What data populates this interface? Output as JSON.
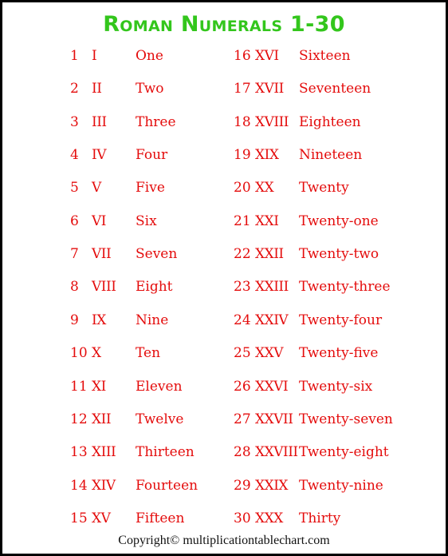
{
  "title": "Roman Numerals 1-30",
  "colors": {
    "title": "#33c61c",
    "entries": "#e40c0c",
    "border": "#000000",
    "copyright": "#111111"
  },
  "left_column": [
    {
      "number": "1",
      "roman": "I",
      "word": "One"
    },
    {
      "number": "2",
      "roman": "II",
      "word": "Two"
    },
    {
      "number": "3",
      "roman": "III",
      "word": "Three"
    },
    {
      "number": "4",
      "roman": "IV",
      "word": "Four"
    },
    {
      "number": "5",
      "roman": "V",
      "word": "Five"
    },
    {
      "number": "6",
      "roman": "VI",
      "word": "Six"
    },
    {
      "number": "7",
      "roman": "VII",
      "word": "Seven"
    },
    {
      "number": "8",
      "roman": "VIII",
      "word": "Eight"
    },
    {
      "number": "9",
      "roman": "IX",
      "word": "Nine"
    },
    {
      "number": "10",
      "roman": "X",
      "word": "Ten"
    },
    {
      "number": "11",
      "roman": "XI",
      "word": "Eleven"
    },
    {
      "number": "12",
      "roman": "XII",
      "word": "Twelve"
    },
    {
      "number": "13",
      "roman": "XIII",
      "word": "Thirteen"
    },
    {
      "number": "14",
      "roman": "XIV",
      "word": "Fourteen"
    },
    {
      "number": "15",
      "roman": "XV",
      "word": "Fifteen"
    }
  ],
  "right_column": [
    {
      "number": "16",
      "roman": "XVI",
      "word": "Sixteen"
    },
    {
      "number": "17",
      "roman": "XVII",
      "word": "Seventeen"
    },
    {
      "number": "18",
      "roman": "XVIII",
      "word": "Eighteen"
    },
    {
      "number": "19",
      "roman": "XIX",
      "word": "Nineteen"
    },
    {
      "number": "20",
      "roman": "XX",
      "word": "Twenty"
    },
    {
      "number": "21",
      "roman": "XXI",
      "word": "Twenty-one"
    },
    {
      "number": "22",
      "roman": "XXII",
      "word": "Twenty-two"
    },
    {
      "number": "23",
      "roman": "XXIII",
      "word": "Twenty-three"
    },
    {
      "number": "24",
      "roman": "XXIV",
      "word": "Twenty-four"
    },
    {
      "number": "25",
      "roman": "XXV",
      "word": "Twenty-five"
    },
    {
      "number": "26",
      "roman": "XXVI",
      "word": "Twenty-six"
    },
    {
      "number": "27",
      "roman": "XXVII",
      "word": "Twenty-seven"
    },
    {
      "number": "28",
      "roman": "XXVIII",
      "word": "Twenty-eight"
    },
    {
      "number": "29",
      "roman": "XXIX",
      "word": "Twenty-nine"
    },
    {
      "number": "30",
      "roman": "XXX",
      "word": "Thirty"
    }
  ],
  "copyright": "Copyright© multiplicationtablechart.com"
}
